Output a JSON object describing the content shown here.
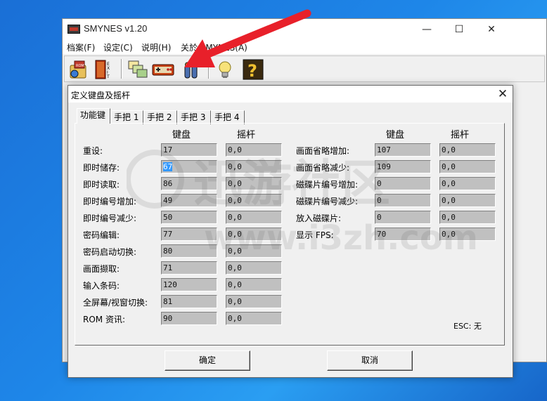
{
  "window": {
    "title": "SMYNES v1.20",
    "controls": {
      "minimize": "—",
      "maximize": "☐",
      "close": "✕"
    }
  },
  "menu": {
    "items": [
      {
        "label": "档案(F)"
      },
      {
        "label": "设定(C)"
      },
      {
        "label": "说明(H)"
      },
      {
        "label": "关於 SMYNES(A)"
      }
    ]
  },
  "toolbar": {
    "icons": [
      "open-rom-icon",
      "exit-icon",
      "windows-icon",
      "nes-controller-icon",
      "joystick-icon",
      "lightbulb-icon",
      "help-icon"
    ]
  },
  "dialog": {
    "title": "定义键盘及摇杆",
    "close": "✕",
    "tabs": [
      "功能键",
      "手把 1",
      "手把 2",
      "手把 3",
      "手把 4"
    ],
    "active_tab": 0,
    "col_keyboard": "键盘",
    "col_joystick": "摇杆",
    "left_rows": [
      {
        "label": "重设:",
        "key": "17",
        "joy": "0,0"
      },
      {
        "label": "即时储存:",
        "key": "67",
        "joy": "0,0",
        "selected": true
      },
      {
        "label": "即时读取:",
        "key": "86",
        "joy": "0,0"
      },
      {
        "label": "即时编号增加:",
        "key": "49",
        "joy": "0,0"
      },
      {
        "label": "即时编号减少:",
        "key": "50",
        "joy": "0,0"
      },
      {
        "label": "密码编辑:",
        "key": "77",
        "joy": "0,0"
      },
      {
        "label": "密码启动切换:",
        "key": "80",
        "joy": "0,0"
      },
      {
        "label": "画面撷取:",
        "key": "71",
        "joy": "0,0"
      },
      {
        "label": "输入条码:",
        "key": "120",
        "joy": "0,0"
      },
      {
        "label": "全屏幕/视窗切换:",
        "key": "81",
        "joy": "0,0"
      },
      {
        "label": "ROM 资讯:",
        "key": "90",
        "joy": "0,0"
      }
    ],
    "right_rows": [
      {
        "label": "画面省略增加:",
        "key": "107",
        "joy": "0,0"
      },
      {
        "label": "画面省略减少:",
        "key": "109",
        "joy": "0,0"
      },
      {
        "label": "磁碟片编号增加:",
        "key": "0",
        "joy": "0,0"
      },
      {
        "label": "磁碟片编号减少:",
        "key": "0",
        "joy": "0,0"
      },
      {
        "label": "放入磁碟片:",
        "key": "0",
        "joy": "0,0"
      },
      {
        "label": "显示 FPS:",
        "key": "70",
        "joy": "0,0"
      }
    ],
    "esc_text": "ESC: 无",
    "ok": "确定",
    "cancel": "取消"
  },
  "watermark": {
    "line1": "迅游社区",
    "line2": "www.i3zh.com"
  },
  "colors": {
    "desktop": "#1e86e8",
    "arrow": "#e8202a",
    "field_bg": "#c0c0c0",
    "selection": "#3399ff"
  }
}
